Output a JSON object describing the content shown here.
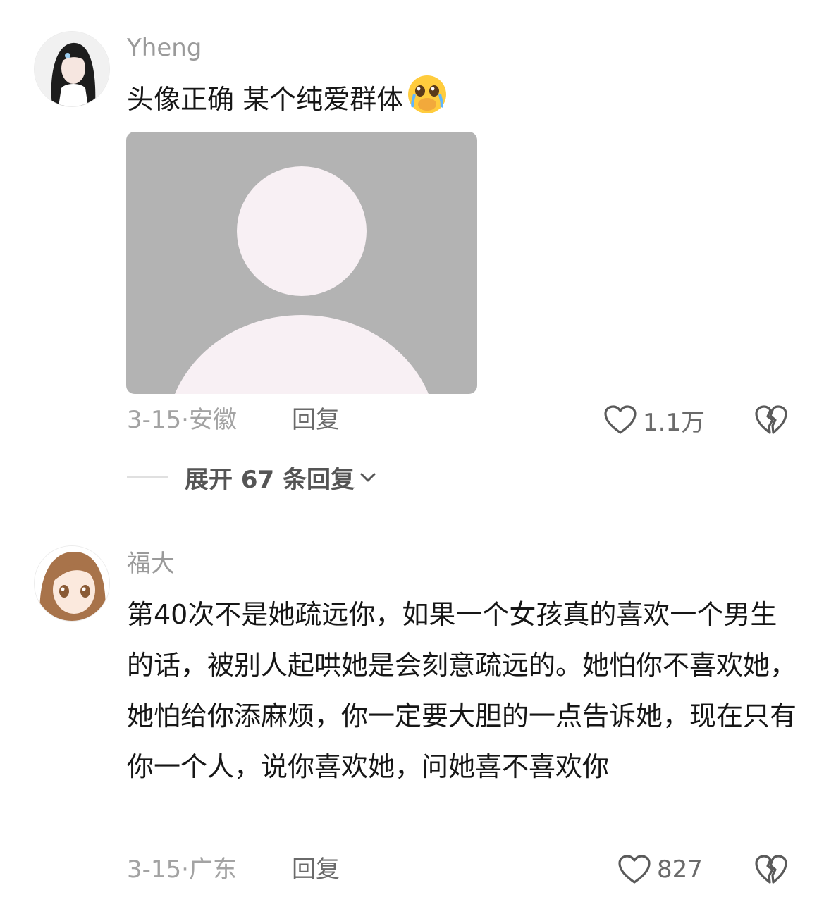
{
  "comments": [
    {
      "username": "Yheng",
      "text": "头像正确 某个纯爱群体",
      "emoji_icon": "crying-covering-mouth-emoji",
      "image_icon": "default-avatar-placeholder",
      "date_location": "3-15·安徽",
      "reply_label": "回复",
      "like_count": "1.1万",
      "expand_label": "展开 67 条回复"
    },
    {
      "username": "福大",
      "text": "第40次不是她疏远你，如果一个女孩真的喜欢一个男生的话，被别人起哄她是会刻意疏远的。她怕你不喜欢她，她怕给你添麻烦，你一定要大胆的一点告诉她，现在只有你一个人，说你喜欢她，问她喜不喜欢你",
      "date_location": "3-15·广东",
      "reply_label": "回复",
      "like_count": "827"
    }
  ],
  "colors": {
    "username": "#9a9a9a",
    "meta": "#a3a3a3",
    "placeholder_bg": "#b3b3b3",
    "placeholder_fg": "#f8f0f4"
  }
}
